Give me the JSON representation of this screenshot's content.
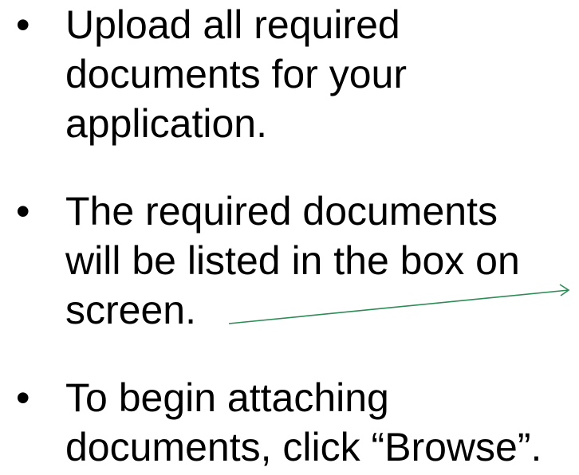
{
  "bullets": [
    {
      "marker": "•",
      "lines": [
        "Upload all required",
        "documents for your",
        "application."
      ]
    },
    {
      "marker": "•",
      "lines": [
        "The required documents",
        "will be listed in the box on",
        "screen."
      ]
    },
    {
      "marker": "•",
      "lines": [
        "To begin attaching",
        "documents, click “Browse”."
      ]
    }
  ],
  "arrow_color": "#2e8b57"
}
